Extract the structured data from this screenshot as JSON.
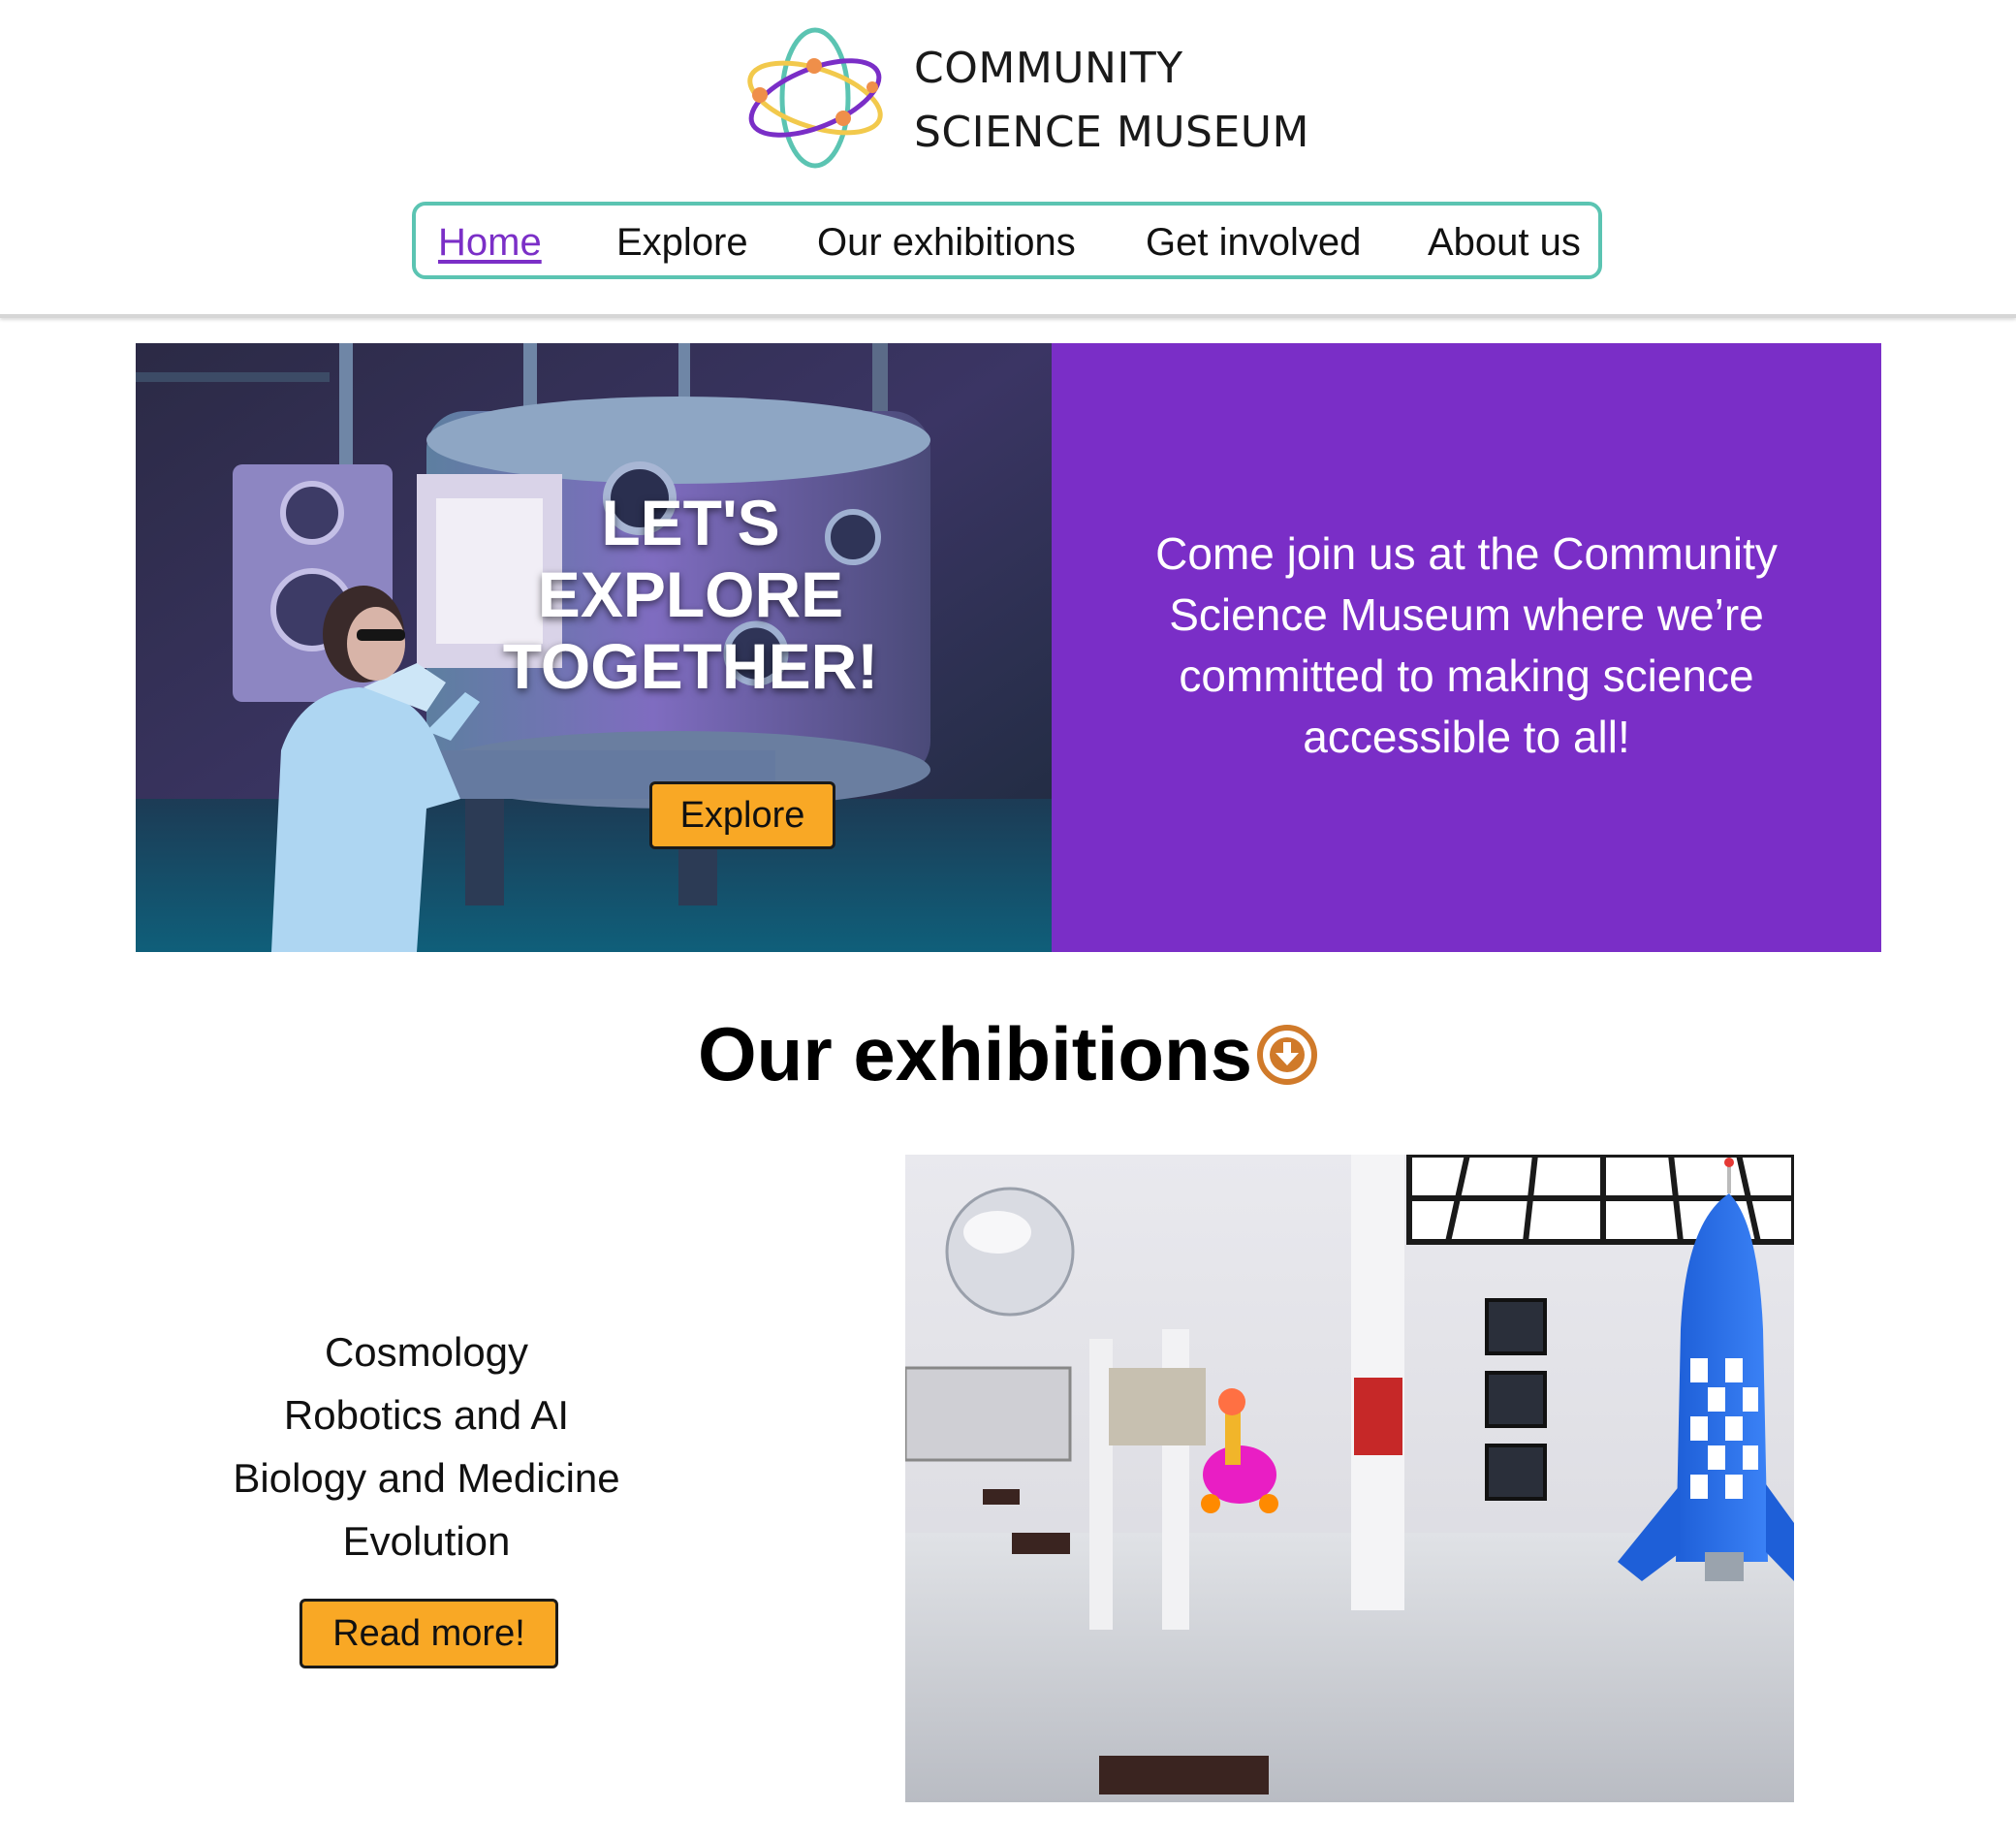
{
  "header": {
    "logo_line1": "COMMUNITY",
    "logo_line2": "SCIENCE MUSEUM",
    "logo_icon": "atom-orbit-icon"
  },
  "nav": {
    "items": [
      {
        "label": "Home",
        "active": true
      },
      {
        "label": "Explore",
        "active": false
      },
      {
        "label": "Our exhibitions",
        "active": false
      },
      {
        "label": "Get involved",
        "active": false
      },
      {
        "label": "About us",
        "active": false
      }
    ]
  },
  "hero": {
    "title_line1": "LET'S",
    "title_line2": "EXPLORE",
    "title_line3": "TOGETHER!",
    "button_label": "Explore",
    "image": "scientist-with-vacuum-chamber-photo",
    "panel_text": "Come join us at the Community Science Museum where we’re committed to making science accessible to all!"
  },
  "exhibitions": {
    "title": "Our exhibitions",
    "icon": "arrow-down-circle-icon",
    "items": [
      "Cosmology",
      "Robotics and AI",
      "Biology and Medicine",
      "Evolution"
    ],
    "button_label": "Read more!",
    "image": "museum-gallery-with-rocket-photo"
  },
  "colors": {
    "accent_purple": "#7a2ec7",
    "nav_border_teal": "#5bc4b2",
    "button_orange": "#f9a825",
    "icon_orange": "#d07a2a"
  }
}
